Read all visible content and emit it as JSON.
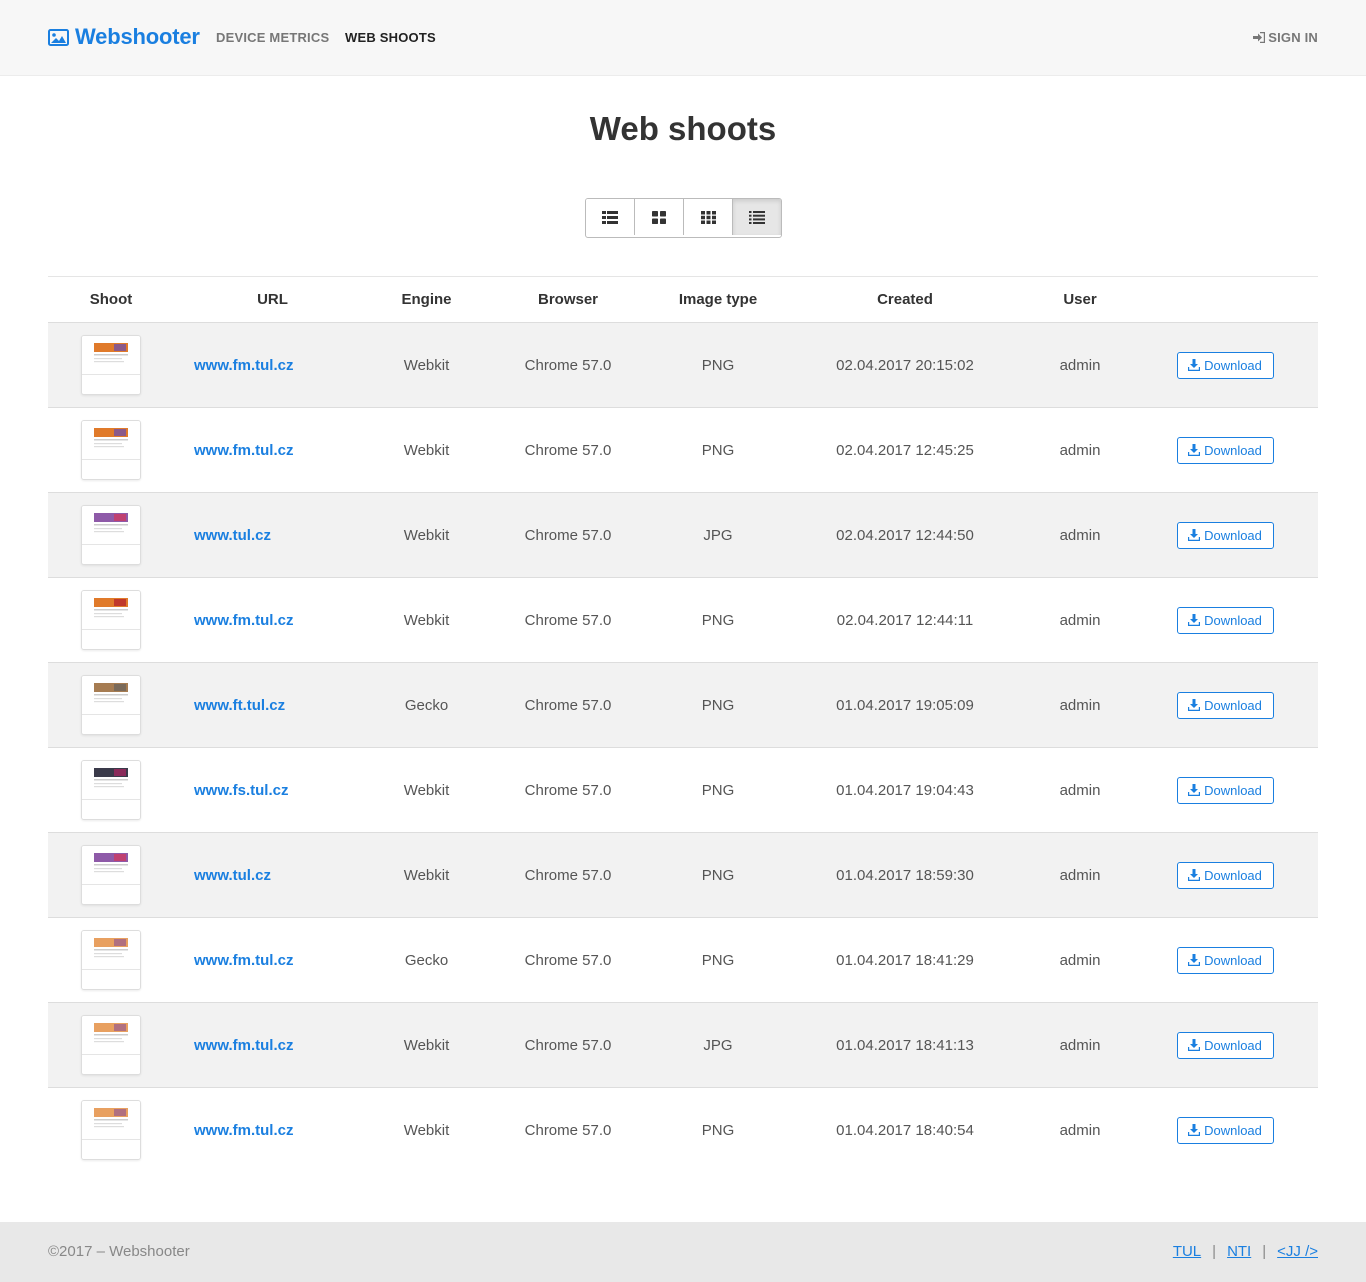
{
  "brand": {
    "name": "Webshooter",
    "icon": "image-icon"
  },
  "nav": {
    "device_metrics": "DEVICE METRICS",
    "web_shoots": "WEB SHOOTS",
    "sign_in": "SIGN IN"
  },
  "page": {
    "title": "Web shoots"
  },
  "view_modes": [
    {
      "icon": "list-thumb-icon",
      "active": false
    },
    {
      "icon": "grid-large-icon",
      "active": false
    },
    {
      "icon": "grid-small-icon",
      "active": false
    },
    {
      "icon": "list-icon",
      "active": true
    }
  ],
  "table": {
    "headers": [
      "Shoot",
      "URL",
      "Engine",
      "Browser",
      "Image type",
      "Created",
      "User",
      ""
    ],
    "download_label": "Download",
    "rows": [
      {
        "url": "www.fm.tul.cz",
        "engine": "Webkit",
        "browser": "Chrome 57.0",
        "image_type": "PNG",
        "created": "02.04.2017 20:15:02",
        "user": "admin",
        "thumb": "orange"
      },
      {
        "url": "www.fm.tul.cz",
        "engine": "Webkit",
        "browser": "Chrome 57.0",
        "image_type": "PNG",
        "created": "02.04.2017 12:45:25",
        "user": "admin",
        "thumb": "orange"
      },
      {
        "url": "www.tul.cz",
        "engine": "Webkit",
        "browser": "Chrome 57.0",
        "image_type": "JPG",
        "created": "02.04.2017 12:44:50",
        "user": "admin",
        "thumb": "purple"
      },
      {
        "url": "www.fm.tul.cz",
        "engine": "Webkit",
        "browser": "Chrome 57.0",
        "image_type": "PNG",
        "created": "02.04.2017 12:44:11",
        "user": "admin",
        "thumb": "orange-tall"
      },
      {
        "url": "www.ft.tul.cz",
        "engine": "Gecko",
        "browser": "Chrome 57.0",
        "image_type": "PNG",
        "created": "01.04.2017 19:05:09",
        "user": "admin",
        "thumb": "brown"
      },
      {
        "url": "www.fs.tul.cz",
        "engine": "Webkit",
        "browser": "Chrome 57.0",
        "image_type": "PNG",
        "created": "01.04.2017 19:04:43",
        "user": "admin",
        "thumb": "dark"
      },
      {
        "url": "www.tul.cz",
        "engine": "Webkit",
        "browser": "Chrome 57.0",
        "image_type": "PNG",
        "created": "01.04.2017 18:59:30",
        "user": "admin",
        "thumb": "purple"
      },
      {
        "url": "www.fm.tul.cz",
        "engine": "Gecko",
        "browser": "Chrome 57.0",
        "image_type": "PNG",
        "created": "01.04.2017 18:41:29",
        "user": "admin",
        "thumb": "orange-small"
      },
      {
        "url": "www.fm.tul.cz",
        "engine": "Webkit",
        "browser": "Chrome 57.0",
        "image_type": "JPG",
        "created": "01.04.2017 18:41:13",
        "user": "admin",
        "thumb": "orange-small"
      },
      {
        "url": "www.fm.tul.cz",
        "engine": "Webkit",
        "browser": "Chrome 57.0",
        "image_type": "PNG",
        "created": "01.04.2017 18:40:54",
        "user": "admin",
        "thumb": "orange-small"
      }
    ]
  },
  "footer": {
    "copyright": "©2017 – Webshooter",
    "links": [
      "TUL",
      "NTI",
      "<JJ />"
    ],
    "separator": "|"
  },
  "colors": {
    "accent": "#1a7fe0",
    "navbar_bg": "#f7f7f7",
    "footer_bg": "#e8e8e8",
    "stripe": "#f2f2f2"
  }
}
